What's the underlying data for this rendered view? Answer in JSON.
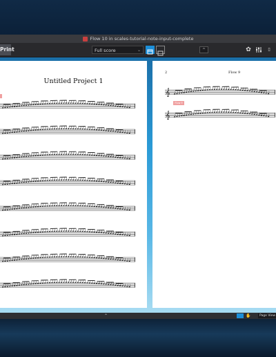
{
  "window": {
    "title": "Flow 10 in scales-tutorial-note-input-complete"
  },
  "toolbar": {
    "mode_label": "Print",
    "layout_selected": "Full score",
    "up_chevron": "^"
  },
  "page1": {
    "title": "Untitled Project 1",
    "system_count": 8
  },
  "page2": {
    "page_number": "2",
    "flow_name": "Flow 9",
    "flow_tag": "Flow 9"
  },
  "statusbar": {
    "view_label": "Page View"
  },
  "colors": {
    "accent": "#1c8ed8",
    "flow_tag": "#f0a0a0"
  },
  "icons": [
    "document-icon",
    "chevron-down-icon",
    "page-view-icon",
    "galley-view-icon",
    "chevron-up-icon",
    "cog-icon",
    "mixer-icon",
    "hand-icon"
  ]
}
